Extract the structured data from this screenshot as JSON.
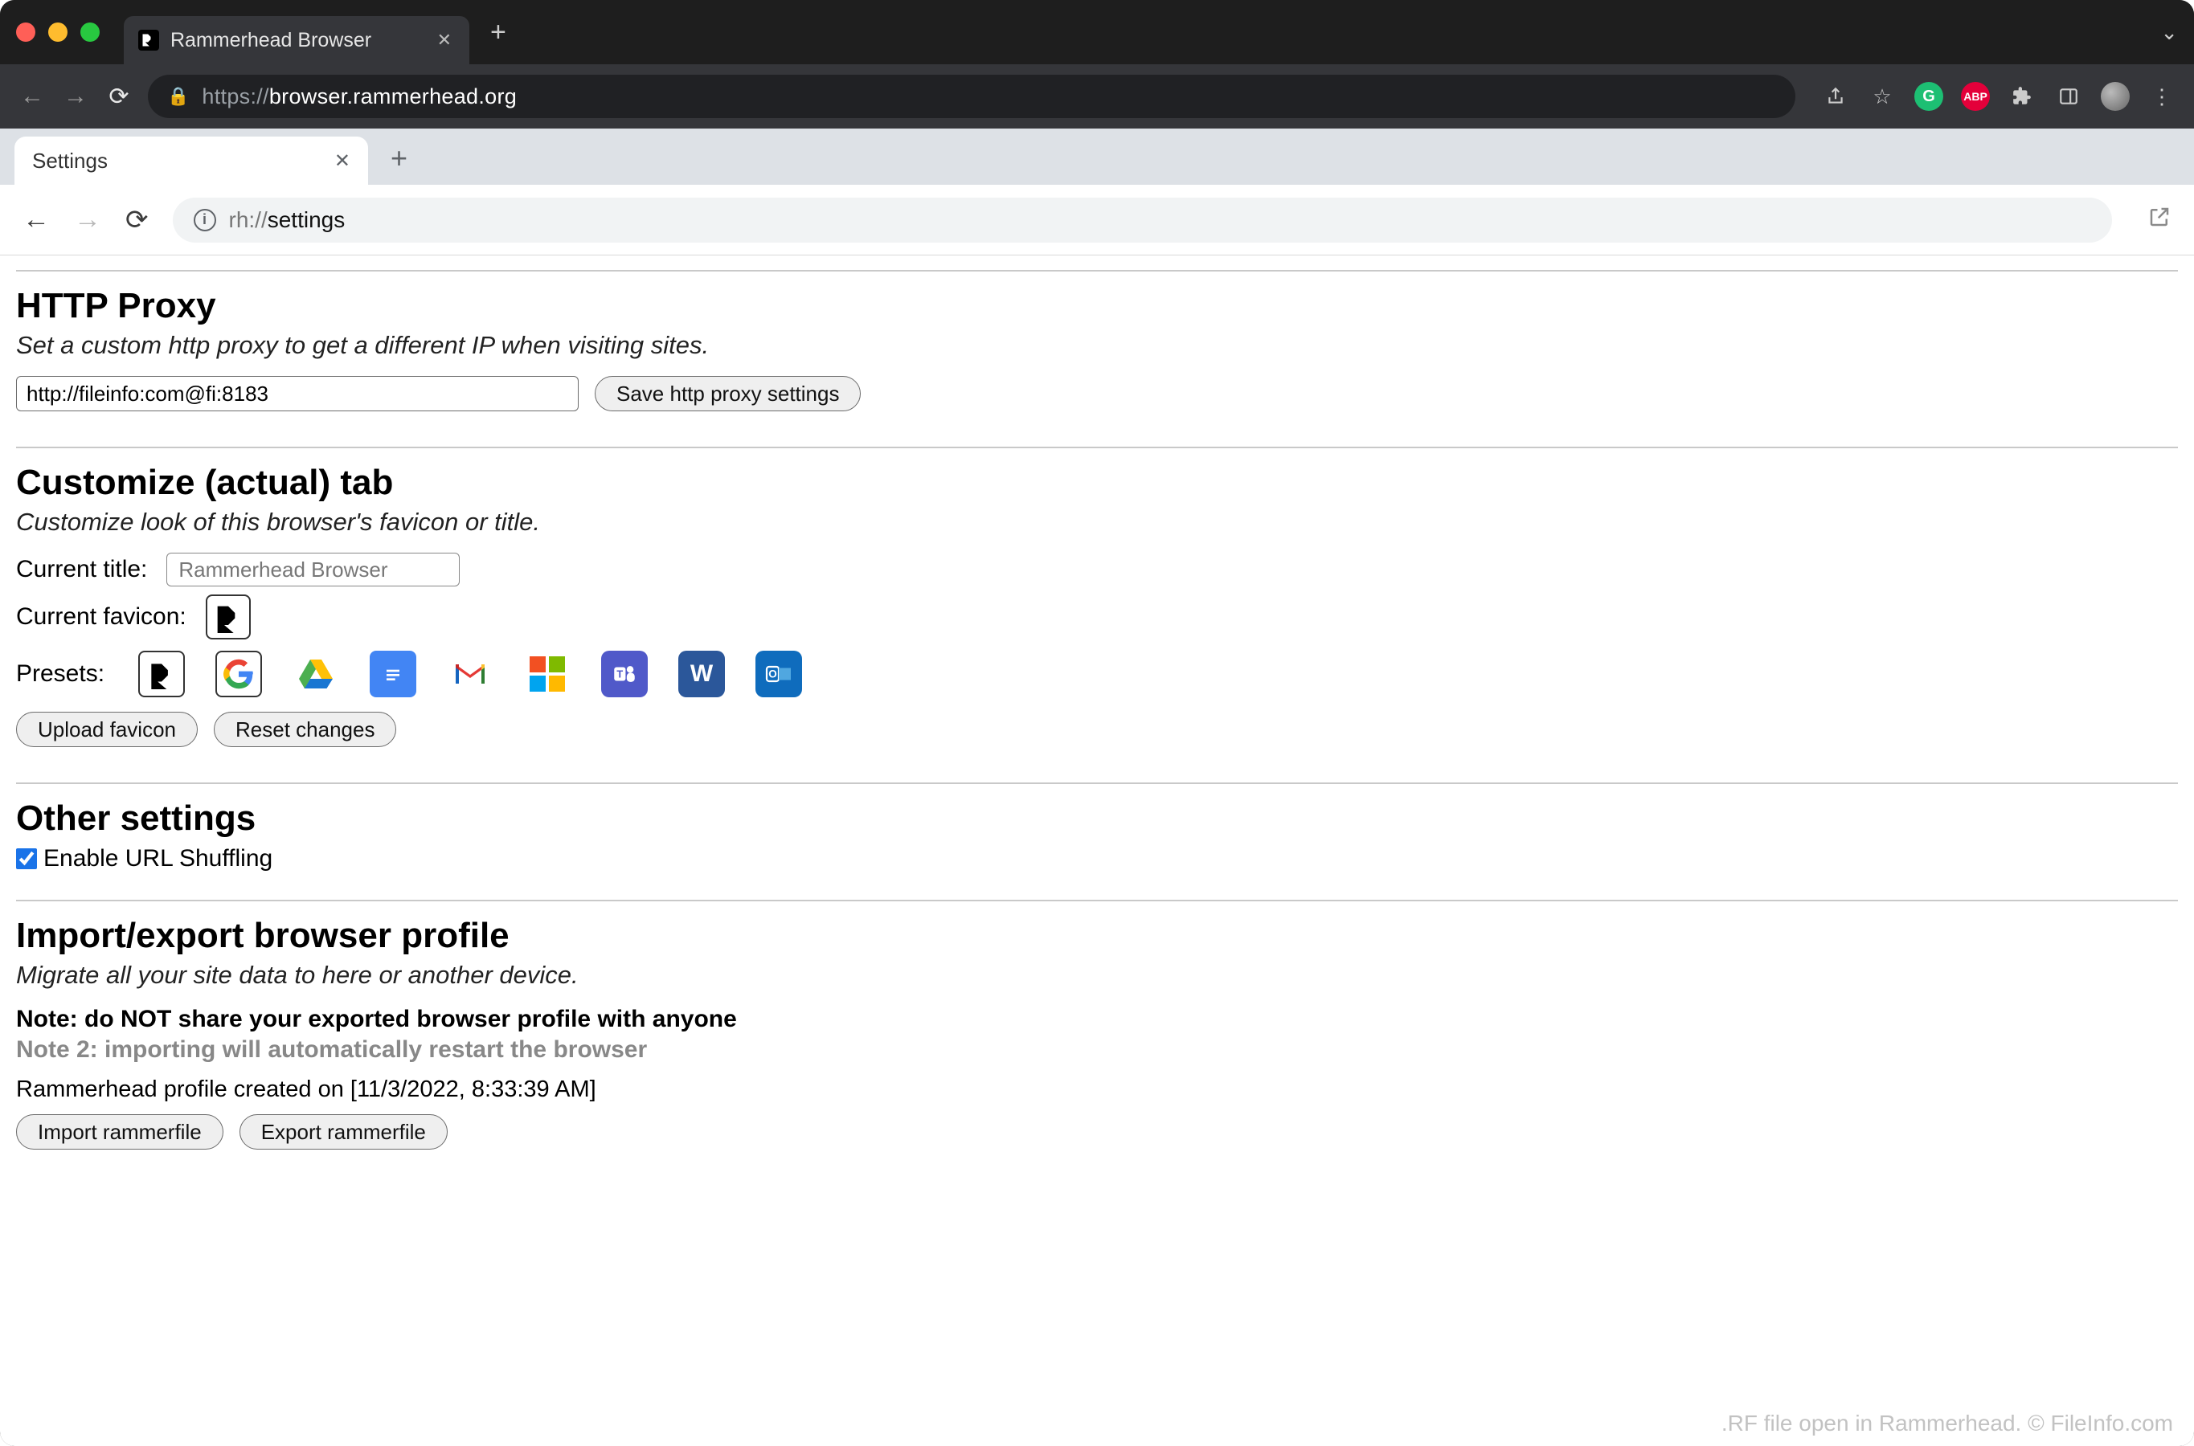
{
  "outerBrowser": {
    "tabTitle": "Rammerhead Browser",
    "url_prefix": "https://",
    "url_host": "browser.rammerhead.org",
    "extensions": {
      "grammarly": "G",
      "abp": "ABP"
    }
  },
  "innerBrowser": {
    "tabTitle": "Settings",
    "url_scheme": "rh://",
    "url_path": "settings"
  },
  "httpProxy": {
    "heading": "HTTP Proxy",
    "desc": "Set a custom http proxy to get a different IP when visiting sites.",
    "value": "http://fileinfo:com@fi:8183",
    "saveBtn": "Save http proxy settings"
  },
  "customizeTab": {
    "heading": "Customize (actual) tab",
    "desc": "Customize look of this browser's favicon or title.",
    "currentTitleLabel": "Current title:",
    "currentTitleValue": "Rammerhead Browser",
    "currentFaviconLabel": "Current favicon:",
    "presetsLabel": "Presets:",
    "presets": [
      "rammerhead",
      "google",
      "google-drive",
      "google-docs",
      "gmail",
      "microsoft",
      "teams",
      "word",
      "outlook"
    ],
    "uploadBtn": "Upload favicon",
    "resetBtn": "Reset changes"
  },
  "otherSettings": {
    "heading": "Other settings",
    "shuffleLabel": "Enable URL Shuffling",
    "shuffleChecked": true
  },
  "importExport": {
    "heading": "Import/export browser profile",
    "desc": "Migrate all your site data to here or another device.",
    "note1": "Note: do NOT share your exported browser profile with anyone",
    "note2": "Note 2: importing will automatically restart the browser",
    "createdPrefix": "Rammerhead profile created on ",
    "createdDate": "[11/3/2022, 8:33:39 AM]",
    "importBtn": "Import rammerfile",
    "exportBtn": "Export rammerfile"
  },
  "watermark": ".RF file open in Rammerhead. © FileInfo.com"
}
